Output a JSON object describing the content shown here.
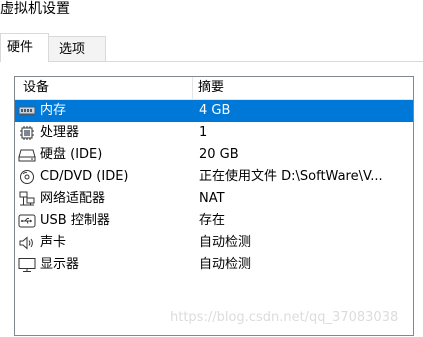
{
  "window": {
    "title": "虚拟机设置"
  },
  "tabs": [
    {
      "label": "硬件",
      "active": true
    },
    {
      "label": "选项",
      "active": false
    }
  ],
  "device_list": {
    "columns": [
      "设备",
      "摘要"
    ],
    "rows": [
      {
        "icon": "memory-icon",
        "name": "内存",
        "summary": "4 GB",
        "selected": true
      },
      {
        "icon": "processor-icon",
        "name": "处理器",
        "summary": "1",
        "selected": false
      },
      {
        "icon": "hard-disk-icon",
        "name": "硬盘 (IDE)",
        "summary": "20 GB",
        "selected": false
      },
      {
        "icon": "cd-dvd-icon",
        "name": "CD/DVD (IDE)",
        "summary": "正在使用文件 D:\\SoftWare\\V...",
        "selected": false
      },
      {
        "icon": "network-adapter-icon",
        "name": "网络适配器",
        "summary": "NAT",
        "selected": false
      },
      {
        "icon": "usb-controller-icon",
        "name": "USB 控制器",
        "summary": "存在",
        "selected": false
      },
      {
        "icon": "sound-card-icon",
        "name": "声卡",
        "summary": "自动检测",
        "selected": false
      },
      {
        "icon": "display-icon",
        "name": "显示器",
        "summary": "自动检测",
        "selected": false
      }
    ]
  },
  "watermark": "https://blog.csdn.net/qq_37083038",
  "colors": {
    "selection": "#0078d7",
    "border": "#828790"
  }
}
